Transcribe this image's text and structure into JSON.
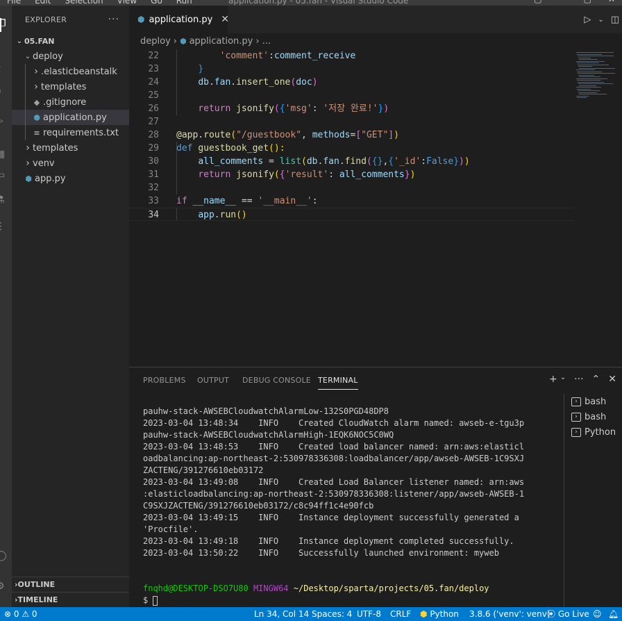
{
  "titlebar": {
    "menu": [
      "File",
      "Edit",
      "Selection",
      "View",
      "Go",
      "Run"
    ],
    "title": "application.py - 05.fan - Visual Studio Code"
  },
  "sidebar": {
    "header": "EXPLORER",
    "root": "05.FAN",
    "items": [
      {
        "label": "deploy",
        "type": "folder-open",
        "depth": 1
      },
      {
        "label": ".elasticbeanstalk",
        "type": "folder",
        "depth": 2
      },
      {
        "label": "templates",
        "type": "folder",
        "depth": 2
      },
      {
        "label": ".gitignore",
        "type": "git",
        "depth": 2
      },
      {
        "label": "application.py",
        "type": "python",
        "depth": 2,
        "selected": true
      },
      {
        "label": "requirements.txt",
        "type": "text",
        "depth": 2
      },
      {
        "label": "templates",
        "type": "folder",
        "depth": 1
      },
      {
        "label": "venv",
        "type": "folder",
        "depth": 1
      },
      {
        "label": "app.py",
        "type": "python",
        "depth": 1
      }
    ],
    "outline": "OUTLINE",
    "timeline": "TIMELINE"
  },
  "editor": {
    "tab_label": "application.py",
    "breadcrumb": {
      "folder": "deploy",
      "file": "application.py",
      "more": "..."
    }
  },
  "code": {
    "lines": [
      {
        "n": "22",
        "tokens": [
          [
            "        ",
            "def"
          ],
          [
            "'comment'",
            "str"
          ],
          [
            ":",
            "def"
          ],
          [
            "comment_receive",
            "var"
          ]
        ]
      },
      {
        "n": "23",
        "tokens": [
          [
            "    ",
            "def"
          ],
          [
            "}",
            "br3"
          ]
        ]
      },
      {
        "n": "24",
        "tokens": [
          [
            "    ",
            "def"
          ],
          [
            "db",
            "var"
          ],
          [
            ".",
            "def"
          ],
          [
            "fan",
            "var"
          ],
          [
            ".",
            "def"
          ],
          [
            "insert_one",
            "fn"
          ],
          [
            "(",
            "br2"
          ],
          [
            "doc",
            "var"
          ],
          [
            ")",
            "br2"
          ]
        ]
      },
      {
        "n": "25",
        "tokens": []
      },
      {
        "n": "26",
        "tokens": [
          [
            "    ",
            "def"
          ],
          [
            "return",
            "ctl"
          ],
          [
            " ",
            "def"
          ],
          [
            "jsonify",
            "fn"
          ],
          [
            "(",
            "br2"
          ],
          [
            "{",
            "br3"
          ],
          [
            "'msg'",
            "str"
          ],
          [
            ": ",
            "def"
          ],
          [
            "'저장 완료!'",
            "str"
          ],
          [
            "}",
            "br3"
          ],
          [
            ")",
            "br2"
          ]
        ]
      },
      {
        "n": "27",
        "tokens": []
      },
      {
        "n": "28",
        "tokens": [
          [
            "@app.route",
            "dec"
          ],
          [
            "(",
            "br1"
          ],
          [
            "\"/guestbook\"",
            "str"
          ],
          [
            ", ",
            "def"
          ],
          [
            "methods",
            "var"
          ],
          [
            "=",
            "def"
          ],
          [
            "[",
            "br2"
          ],
          [
            "\"GET\"",
            "str"
          ],
          [
            "]",
            "br2"
          ],
          [
            ")",
            "br1"
          ]
        ]
      },
      {
        "n": "29",
        "tokens": [
          [
            "def",
            "kw"
          ],
          [
            " ",
            "def"
          ],
          [
            "guestbook_get",
            "fn"
          ],
          [
            "():",
            "br1"
          ]
        ]
      },
      {
        "n": "30",
        "tokens": [
          [
            "    ",
            "def"
          ],
          [
            "all_comments",
            "var"
          ],
          [
            " = ",
            "def"
          ],
          [
            "list",
            "cls"
          ],
          [
            "(",
            "br1"
          ],
          [
            "db",
            "var"
          ],
          [
            ".",
            "def"
          ],
          [
            "fan",
            "var"
          ],
          [
            ".",
            "def"
          ],
          [
            "find",
            "fn"
          ],
          [
            "(",
            "br2"
          ],
          [
            "{}",
            "br3"
          ],
          [
            ",",
            "def"
          ],
          [
            "{",
            "br3"
          ],
          [
            "'_id'",
            "str"
          ],
          [
            ":",
            "def"
          ],
          [
            "False",
            "bool"
          ],
          [
            "}",
            "br3"
          ],
          [
            ")",
            "br2"
          ],
          [
            ")",
            "br1"
          ]
        ]
      },
      {
        "n": "31",
        "tokens": [
          [
            "    ",
            "def"
          ],
          [
            "return",
            "ctl"
          ],
          [
            " ",
            "def"
          ],
          [
            "jsonify",
            "fn"
          ],
          [
            "(",
            "br1"
          ],
          [
            "{",
            "br2"
          ],
          [
            "'result'",
            "str"
          ],
          [
            ": ",
            "def"
          ],
          [
            "all_comments",
            "var"
          ],
          [
            "}",
            "br2"
          ],
          [
            ")",
            "br1"
          ]
        ]
      },
      {
        "n": "32",
        "tokens": []
      },
      {
        "n": "33",
        "tokens": [
          [
            "if",
            "ctl"
          ],
          [
            " ",
            "def"
          ],
          [
            "__name__",
            "var"
          ],
          [
            " == ",
            "def"
          ],
          [
            "'__main__'",
            "str"
          ],
          [
            ":",
            "def"
          ]
        ]
      },
      {
        "n": "34",
        "tokens": [
          [
            "    ",
            "def"
          ],
          [
            "app",
            "var"
          ],
          [
            ".",
            "def"
          ],
          [
            "run",
            "fn"
          ],
          [
            "()",
            "br1"
          ]
        ]
      }
    ]
  },
  "panel": {
    "tabs": [
      "PROBLEMS",
      "OUTPUT",
      "DEBUG CONSOLE",
      "TERMINAL"
    ],
    "active_tab": "TERMINAL",
    "terminal_lines": [
      "pauhw-stack-AWSEBCloudwatchAlarmLow-132S0PGD48DP8",
      "2023-03-04 13:48:34    INFO    Created CloudWatch alarm named: awseb-e-tgu3p",
      "pauhw-stack-AWSEBCloudwatchAlarmHigh-1EQK6NOC5C0WQ",
      "2023-03-04 13:48:53    INFO    Created load balancer named: arn:aws:elasticl",
      "oadbalancing:ap-northeast-2:530978336308:loadbalancer/app/awseb-AWSEB-1C9SXJ",
      "ZACTENG/391276610eb03172",
      "2023-03-04 13:49:08    INFO    Created Load Balancer listener named: arn:aws",
      ":elasticloadbalancing:ap-northeast-2:530978336308:listener/app/awseb-AWSEB-1",
      "C9SXJZACTENG/391276610eb03172/c8c94ff1c4e90fcb",
      "2023-03-04 13:49:15    INFO    Instance deployment successfully generated a",
      "'Procfile'.",
      "2023-03-04 13:49:18    INFO    Instance deployment completed successfully.",
      "2023-03-04 13:50:22    INFO    Successfully launched environment: myweb"
    ],
    "prompt": {
      "user": "fnqhd@DESKTOP-DSO7U80",
      "host": "MINGW64",
      "path": "~/Desktop/sparta/projects/05.fan/deploy",
      "symbol": "$"
    },
    "terminals": [
      "bash",
      "bash",
      "Python"
    ]
  },
  "statusbar": {
    "problems": "⊗ 0  ⚠ 0",
    "position": "Ln 34, Col 14",
    "spaces": "Spaces: 4",
    "encoding": "UTF-8",
    "eol": "CRLF",
    "language": "Python",
    "interpreter": "3.8.6 ('venv': venv)",
    "golive": "Go Live"
  }
}
